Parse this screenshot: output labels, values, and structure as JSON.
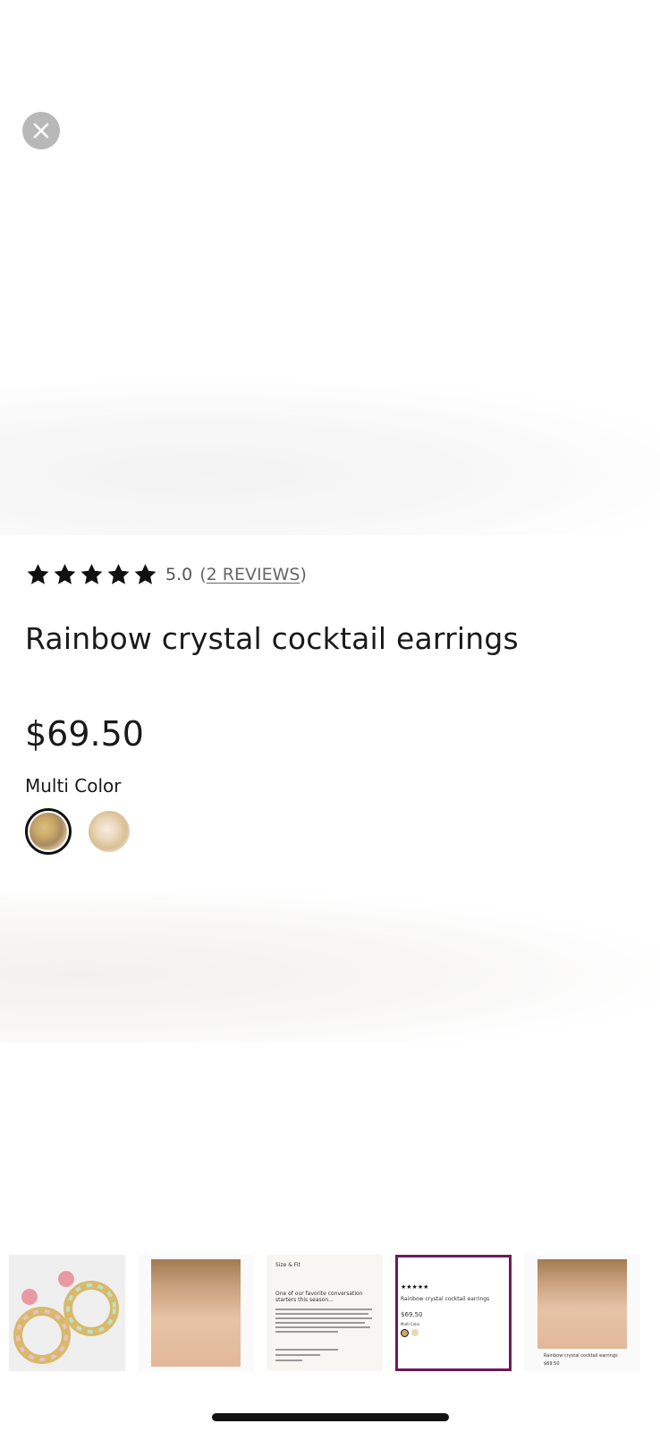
{
  "close_button": {
    "icon": "close-icon"
  },
  "rating": {
    "stars": 5,
    "value": "5.0",
    "reviews_open": "(",
    "reviews_text": "2 REVIEWS",
    "reviews_close": ")"
  },
  "product": {
    "title": "Rainbow crystal cocktail earrings",
    "price": "$69.50",
    "color_label": "Multi Color"
  },
  "swatches": [
    {
      "name": "multi-color",
      "selected": true
    },
    {
      "name": "gold",
      "selected": false
    }
  ],
  "thumbnails": {
    "selected_index": 3,
    "accent_color": "#6b1a5b",
    "t3": {
      "heading": "Size & Fit",
      "tagline": "One of our favorite conversation starters this season..."
    },
    "t4": {
      "title": "Rainbow crystal cocktail earrings",
      "price": "$69.50",
      "color": "Multi Color"
    },
    "t5": {
      "title": "Rainbow crystal cocktail earrings",
      "price": "$69.50"
    }
  }
}
